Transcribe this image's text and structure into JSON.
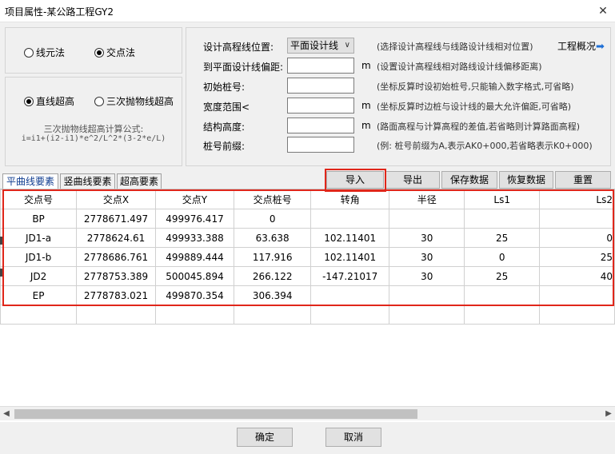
{
  "window": {
    "title": "项目属性-某公路工程GY2",
    "close": "✕"
  },
  "method": {
    "options": [
      "线元法",
      "交点法"
    ],
    "selected": 1
  },
  "superelevation": {
    "options": [
      "直线超高",
      "三次抛物线超高"
    ],
    "selected": 0,
    "formula_title": "三次抛物线超高计算公式:",
    "formula": "i=i1+(i2-i1)*e^2/L^2*(3-2*e/L)"
  },
  "form": {
    "design_line_label": "设计高程线位置:",
    "design_line_value": "平面设计线",
    "design_line_hint": "(选择设计高程线与线路设计线相对位置)",
    "overview_link": "工程概况",
    "offset_label": "到平面设计线偏距:",
    "offset_unit": "m",
    "offset_hint": "(设置设计高程线相对路线设计线偏移距离)",
    "start_label": "初始桩号:",
    "start_hint": "(坐标反算时设初始桩号,只能输入数字格式,可省略)",
    "width_label": "宽度范围<",
    "width_unit": "m",
    "width_hint": "(坐标反算时边桩与设计线的最大允许偏距,可省略)",
    "struct_label": "结构高度:",
    "struct_unit": "m",
    "struct_hint": "(路面高程与计算高程的差值,若省略则计算路面高程)",
    "prefix_label": "桩号前缀:",
    "prefix_hint": "(例: 桩号前缀为A,表示AK0+000,若省略表示K0+000)"
  },
  "tabs": [
    "平曲线要素",
    "竖曲线要素",
    "超高要素"
  ],
  "toolbar": {
    "import": "导入",
    "export": "导出",
    "save": "保存数据",
    "restore": "恢复数据",
    "reset": "重置"
  },
  "table": {
    "headers": [
      "交点号",
      "交点X",
      "交点Y",
      "交点桩号",
      "转角",
      "半径",
      "Ls1",
      "Ls2"
    ],
    "rows": [
      [
        "BP",
        "2778671.497",
        "499976.417",
        "0",
        "",
        "",
        "",
        ""
      ],
      [
        "JD1-a",
        "2778624.61",
        "499933.388",
        "63.638",
        "102.11401",
        "30",
        "25",
        "0"
      ],
      [
        "JD1-b",
        "2778686.761",
        "499889.444",
        "117.916",
        "102.11401",
        "30",
        "0",
        "25"
      ],
      [
        "JD2",
        "2778753.389",
        "500045.894",
        "266.122",
        "-147.21017",
        "30",
        "25",
        "40"
      ],
      [
        "EP",
        "2778783.021",
        "499870.354",
        "306.394",
        "",
        "",
        "",
        ""
      ]
    ]
  },
  "footer": {
    "ok": "确定",
    "cancel": "取消"
  },
  "colors": {
    "highlight": "#e0261a",
    "link_arrow": "#1e6fd6",
    "active_tab_text": "#0f3c8f"
  }
}
